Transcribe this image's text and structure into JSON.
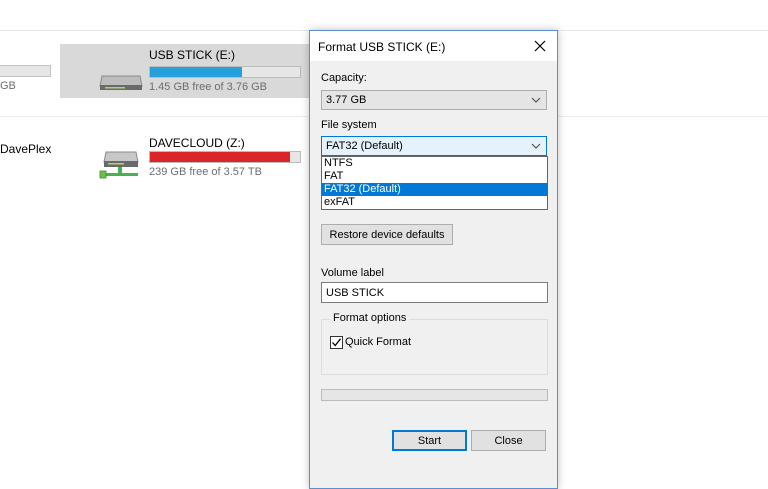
{
  "background": {
    "left_partial": {
      "free_text": "GB",
      "name": "DavePlex"
    },
    "drives": [
      {
        "name": "USB STICK (E:)",
        "free": "1.45 GB free of 3.76 GB",
        "used_fraction": 0.61,
        "bar_color": "#26a0da",
        "icon": "usb-drive-icon",
        "selected": true
      },
      {
        "name": "DAVECLOUD (Z:)",
        "free": "239 GB free of 3.57 TB",
        "used_fraction": 0.93,
        "bar_color": "#da2626",
        "icon": "network-drive-icon",
        "selected": false
      }
    ]
  },
  "dialog": {
    "title": "Format USB STICK (E:)",
    "capacity_label": "Capacity:",
    "capacity_value": "3.77 GB",
    "filesystem_label": "File system",
    "filesystem_value": "FAT32 (Default)",
    "filesystem_options": [
      "NTFS",
      "FAT",
      "FAT32 (Default)",
      "exFAT"
    ],
    "filesystem_selected_index": 2,
    "restore_button": "Restore device defaults",
    "volume_label": "Volume label",
    "volume_value": "USB STICK",
    "format_options_label": "Format options",
    "quick_format_label": "Quick Format",
    "quick_format_checked": true,
    "progress_fraction": 0,
    "start_button": "Start",
    "close_button": "Close"
  },
  "colors": {
    "accent": "#0078d7",
    "selection": "#0078d7",
    "usb_bar": "#26a0da",
    "cloud_bar": "#da2626"
  }
}
